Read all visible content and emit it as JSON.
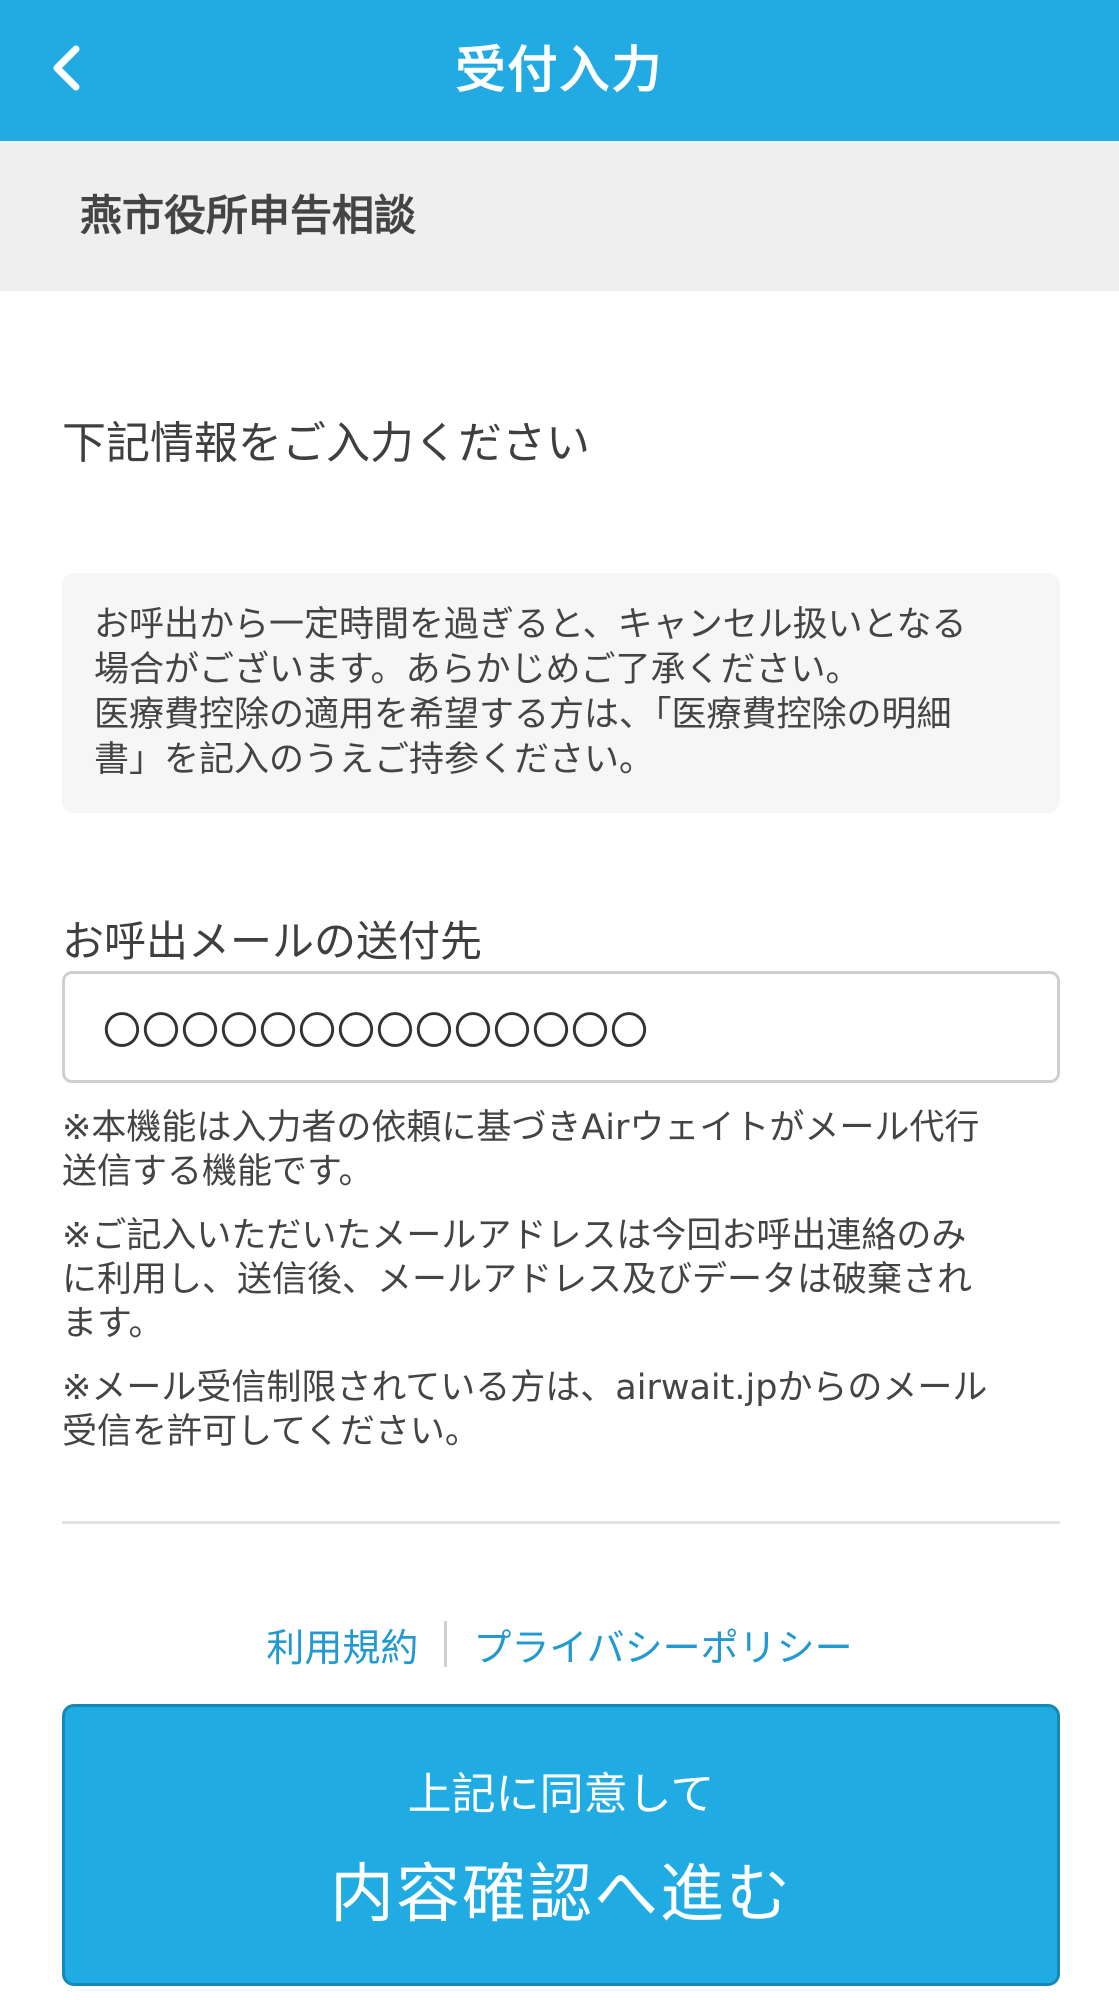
{
  "header": {
    "title": "受付入力",
    "back_icon": "chevron-left-icon"
  },
  "subheader": {
    "title": "燕市役所申告相談"
  },
  "instruction": "下記情報をご入力ください",
  "notice": {
    "line1": "お呼出から一定時間を過ぎると、キャンセル扱いとなる",
    "line2": "場合がございます。あらかじめご了承ください。",
    "line3": "医療費控除の適用を希望する方は、「医療費控除の明細",
    "line4": "書」を記入のうえご持参ください。"
  },
  "email": {
    "label": "お呼出メールの送付先",
    "value": "〇〇〇〇〇〇〇〇〇〇〇〇〇〇"
  },
  "notes": {
    "note1_line1": "※本機能は入力者の依頼に基づきAirウェイトがメール代行",
    "note1_line2": "送信する機能です。",
    "note2_line1": "※ご記入いただいたメールアドレスは今回お呼出連絡のみ",
    "note2_line2": "に利用し、送信後、メールアドレス及びデータは破棄され",
    "note2_line3": "ます。",
    "note3_line1": "※メール受信制限されている方は、airwait.jpからのメール",
    "note3_line2": "受信を許可してください。"
  },
  "links": {
    "terms": "利用規約",
    "privacy": "プライバシーポリシー"
  },
  "submit": {
    "sub_label": "上記に同意して",
    "main_label": "内容確認へ進む"
  },
  "colors": {
    "header_bg": "#21abe2",
    "subheader_bg": "#efefef",
    "link": "#2299cf",
    "button_bg": "#20ace2"
  }
}
